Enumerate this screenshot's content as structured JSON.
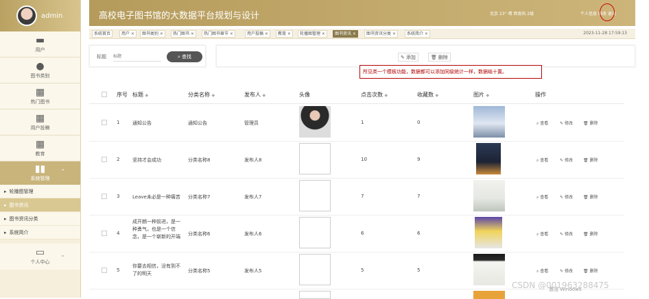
{
  "sidebar": {
    "username": "admin",
    "items": [
      {
        "label": "用户",
        "icon": "monitor-icon"
      },
      {
        "label": "图书类别",
        "icon": "person-icon"
      },
      {
        "label": "热门图书",
        "icon": "grid-icon"
      },
      {
        "label": "用户投稿",
        "icon": "grid-icon"
      },
      {
        "label": "教育",
        "icon": "grid-icon"
      }
    ],
    "group": {
      "label": "系统管理",
      "icon": "bar-chart-icon"
    },
    "subitems": [
      {
        "label": "轮播图管理"
      },
      {
        "label": "图书资讯"
      },
      {
        "label": "图书资讯分类"
      },
      {
        "label": "系统简介"
      }
    ],
    "bottom": {
      "label": "个人中心",
      "icon": "wallet-icon"
    }
  },
  "header": {
    "title": "高校电子图书馆的大数据平台规划与设计",
    "weather": "北京  23°  晴  西南风  2级",
    "links": "个人信息  修改  退出"
  },
  "tabs": [
    {
      "label": "系统首页"
    },
    {
      "label": "用户 ×"
    },
    {
      "label": "图书类别 ×"
    },
    {
      "label": "热门图书 ×"
    },
    {
      "label": "热门图书章节 ×"
    },
    {
      "label": "用户投稿 ×"
    },
    {
      "label": "教育 ×"
    },
    {
      "label": "轮播图管理 ×"
    },
    {
      "label": "图书资讯 ×",
      "active": true
    },
    {
      "label": "图书资讯分类 ×"
    },
    {
      "label": "系统简介 ×"
    }
  ],
  "datetime": "2023-11-28 17:59:13",
  "search": {
    "label": "标题",
    "placeholder": "标题",
    "button": "查找"
  },
  "actions": {
    "add": "添加",
    "delete": "删除"
  },
  "note": "所见类一个模板功能，数据都可以添加同级统计一样，数据结十置。",
  "table": {
    "headers": [
      "序号",
      "标题",
      "分类名称",
      "发布人",
      "头像",
      "点击次数",
      "收藏数",
      "图片",
      "操作"
    ],
    "rows": [
      {
        "index": "1",
        "title": "通知公告",
        "category": "通知公告",
        "publisher": "管理员",
        "clicks": "1",
        "favorites": "0"
      },
      {
        "index": "2",
        "title": "坚持才会成功",
        "category": "分类名称8",
        "publisher": "发布人8",
        "clicks": "10",
        "favorites": "9"
      },
      {
        "index": "3",
        "title": "Leave未必是一种痛苦",
        "category": "分类名称7",
        "publisher": "发布人7",
        "clicks": "7",
        "favorites": "7"
      },
      {
        "index": "4",
        "title": "成开朗一种前进，是一种勇气，也是一个信念，是一个崭新的开端",
        "category": "分类名称6",
        "publisher": "发布人6",
        "clicks": "6",
        "favorites": "6"
      },
      {
        "index": "5",
        "title": "你要去相信，没有到不了的明天",
        "category": "分类名称5",
        "publisher": "发布人5",
        "clicks": "5",
        "favorites": "5"
      }
    ],
    "ops": {
      "view": "查看",
      "edit": "修改",
      "del": "删除"
    }
  },
  "watermark": "CSDN @00196328847​5",
  "win_note": "激活 Windows"
}
